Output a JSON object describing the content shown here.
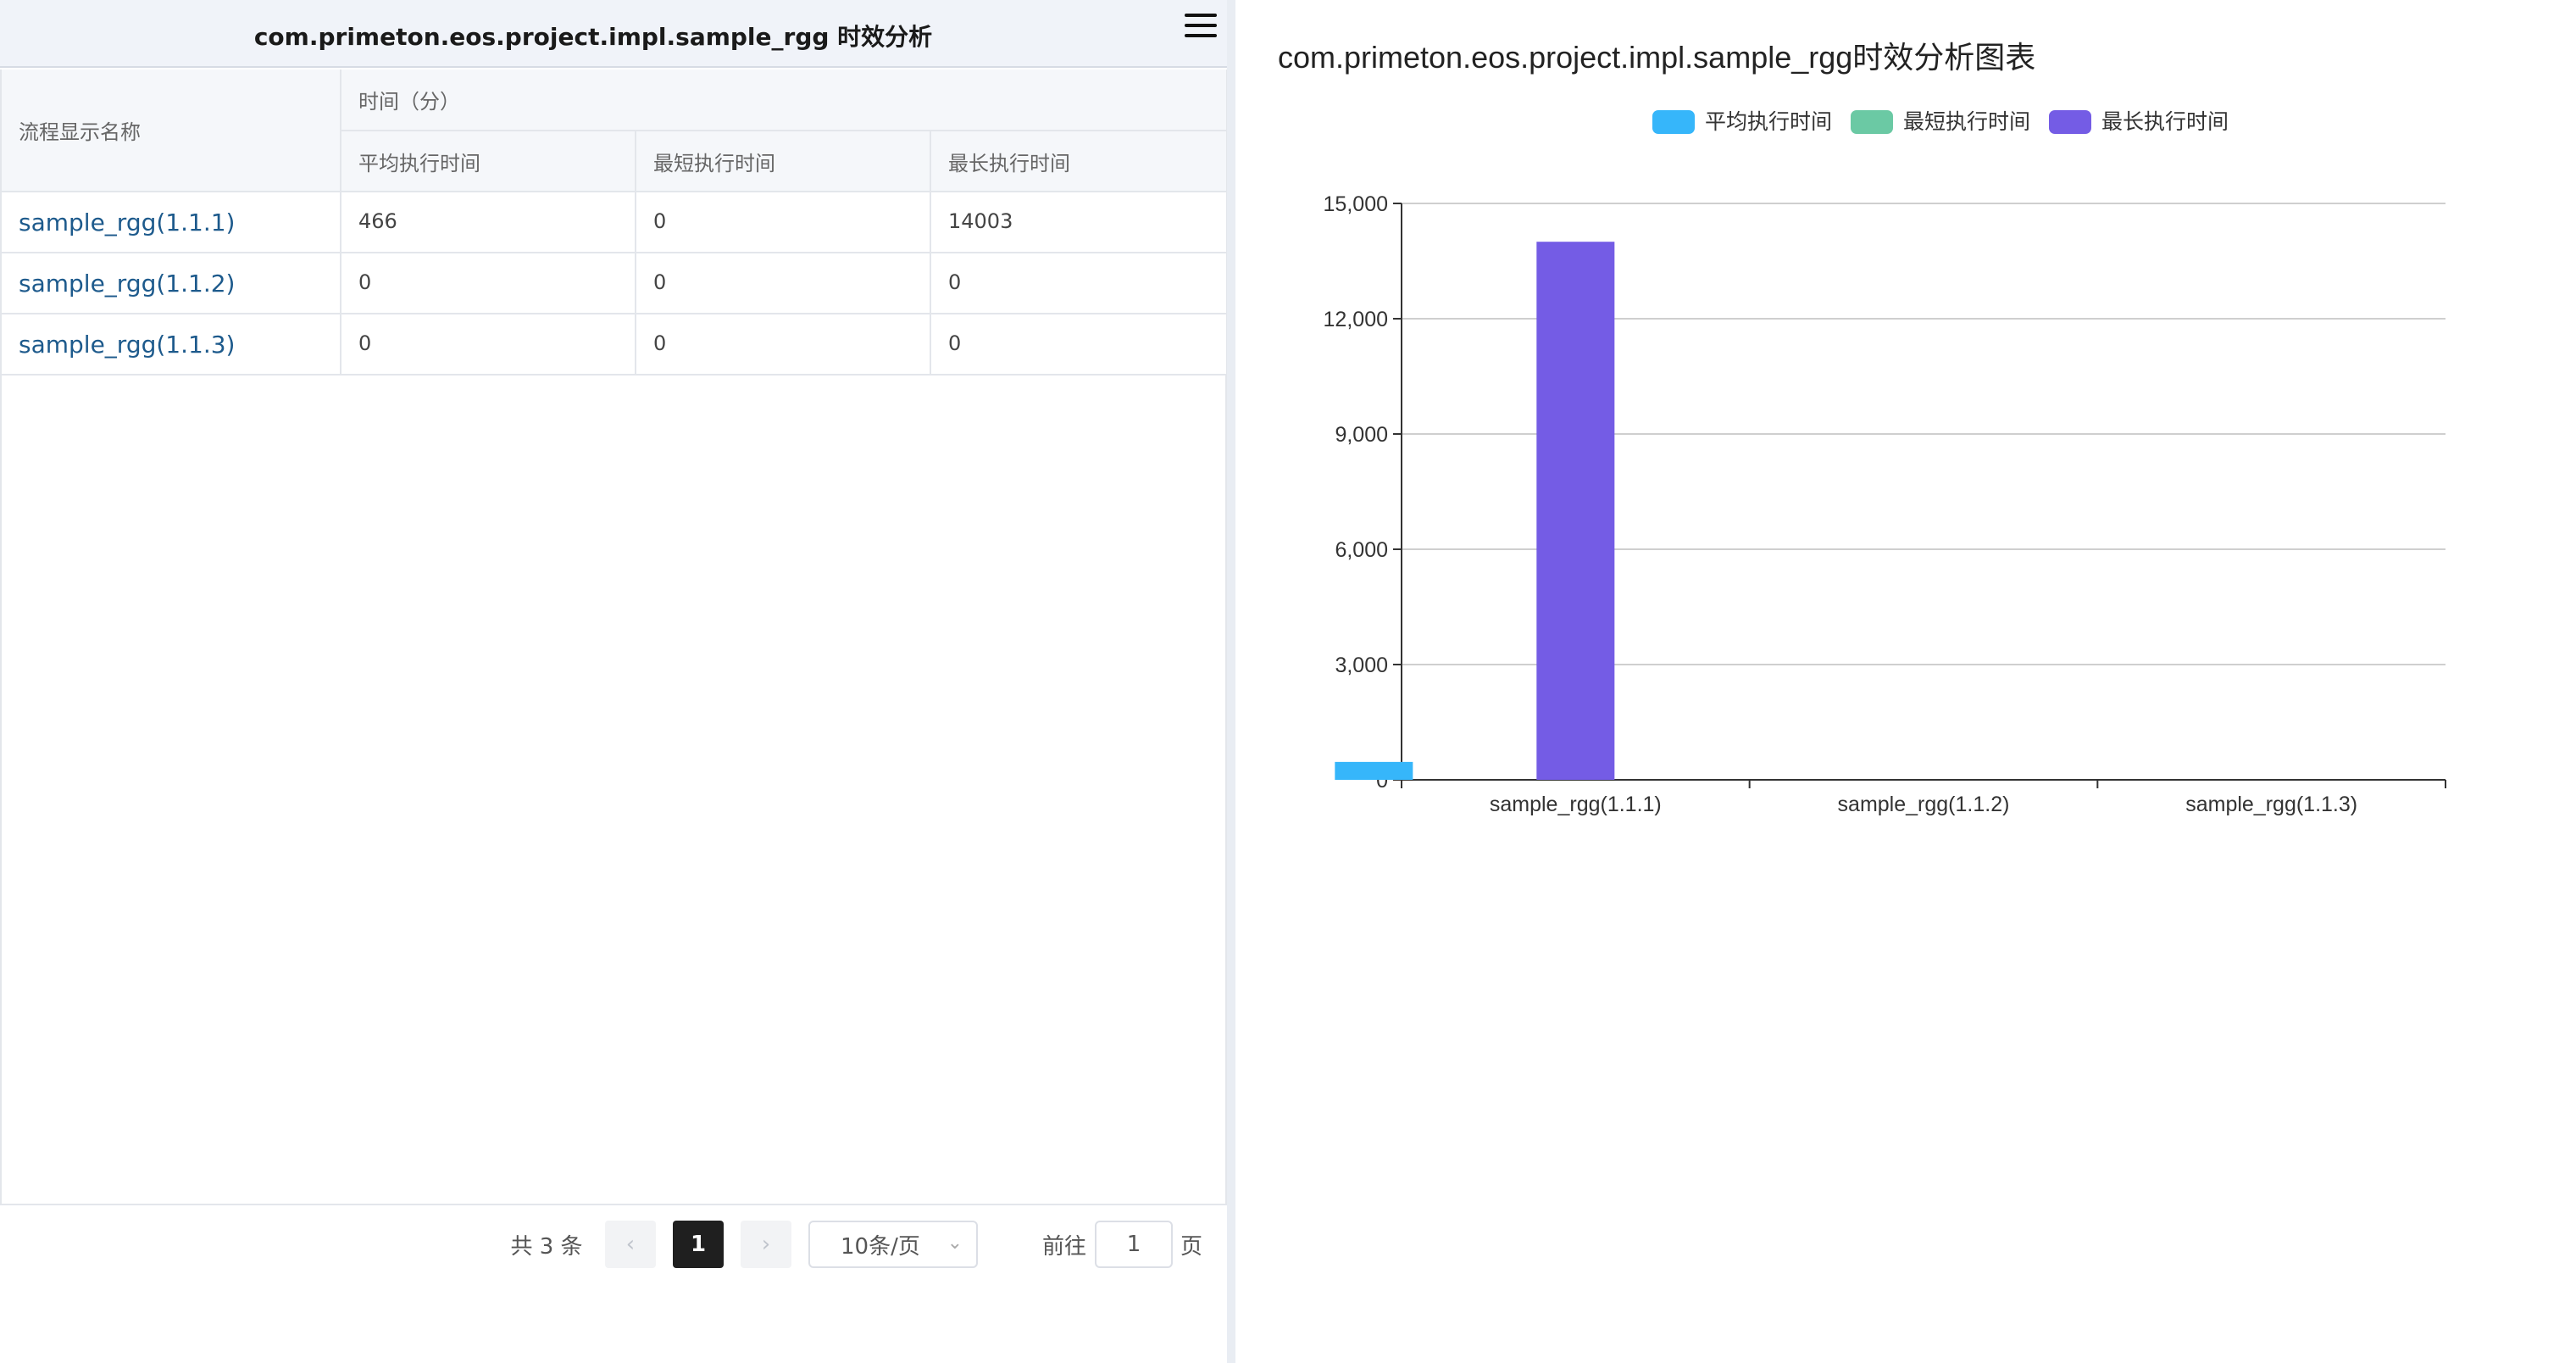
{
  "left": {
    "title": "com.primeton.eos.project.impl.sample_rgg 时效分析",
    "table": {
      "name_header": "流程显示名称",
      "group_header": "时间（分）",
      "columns": [
        "平均执行时间",
        "最短执行时间",
        "最长执行时间"
      ],
      "rows": [
        {
          "name": "sample_rgg(1.1.1)",
          "avg": "466",
          "min": "0",
          "max": "14003"
        },
        {
          "name": "sample_rgg(1.1.2)",
          "avg": "0",
          "min": "0",
          "max": "0"
        },
        {
          "name": "sample_rgg(1.1.3)",
          "avg": "0",
          "min": "0",
          "max": "0"
        }
      ]
    },
    "pagination": {
      "total_text": "共 3 条",
      "prev_symbol": "‹",
      "current_page": "1",
      "next_symbol": "›",
      "page_size": "10条/页",
      "goto_label": "前往",
      "goto_value": "1",
      "page_unit": "页"
    }
  },
  "chart_data": {
    "type": "bar",
    "title": "com.primeton.eos.project.impl.sample_rgg时效分析图表",
    "categories": [
      "sample_rgg(1.1.1)",
      "sample_rgg(1.1.2)",
      "sample_rgg(1.1.3)"
    ],
    "series": [
      {
        "name": "平均执行时间",
        "values": [
          466,
          0,
          0
        ],
        "color": "#36b6fa"
      },
      {
        "name": "最短执行时间",
        "values": [
          0,
          0,
          0
        ],
        "color": "#6bc9a4"
      },
      {
        "name": "最长执行时间",
        "values": [
          14003,
          0,
          0
        ],
        "color": "#745ce5"
      }
    ],
    "ylim": [
      0,
      15000
    ],
    "yticks": [
      "0",
      "3,000",
      "6,000",
      "9,000",
      "12,000",
      "15,000"
    ],
    "grid": true,
    "legend_position": "top-center",
    "xlabel": "",
    "ylabel": ""
  }
}
